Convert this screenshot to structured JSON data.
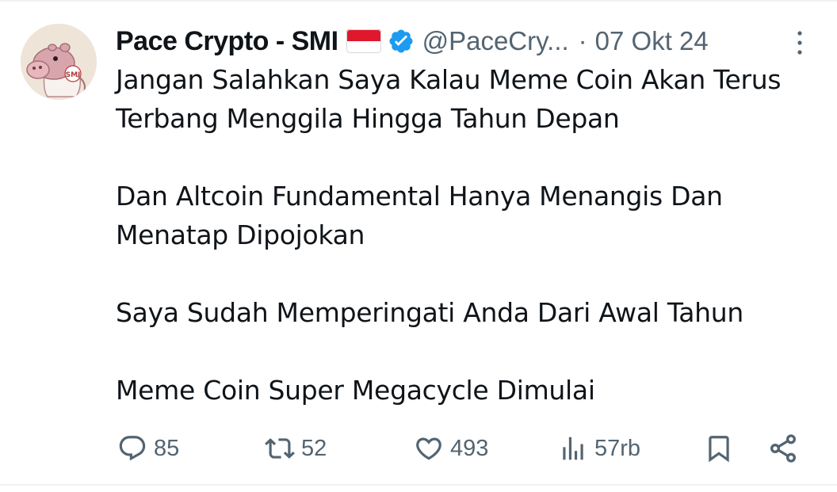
{
  "tweet": {
    "author_name": "Pace Crypto - SMI",
    "handle": "@PaceCry...",
    "separator": "·",
    "date": "07 Okt 24",
    "avatar_badge": "SMI",
    "paragraphs": [
      {
        "line1": "Jangan Salahkan Saya Kalau Meme Coin Akan Terus",
        "line2": "Terbang Menggila Hingga Tahun Depan"
      },
      {
        "line1": "Dan Altcoin Fundamental Hanya Menangis Dan",
        "line2": "Menatap Dipojokan"
      },
      {
        "line1": "Saya Sudah Memperingati Anda Dari Awal Tahun",
        "line2": ""
      },
      {
        "line1": "Meme Coin Super Megacycle Dimulai",
        "line2": ""
      }
    ],
    "actions": {
      "replies": "85",
      "reposts": "52",
      "likes": "493",
      "views": "57rb"
    },
    "icons": {
      "flag": "indonesia-flag-icon",
      "verified": "verified-badge-icon",
      "more": "more-dots-icon",
      "reply": "reply-bubble-icon",
      "repost": "repost-arrows-icon",
      "like": "heart-icon",
      "views": "views-bars-icon",
      "bookmark": "bookmark-icon",
      "share": "share-icon"
    },
    "colors": {
      "text": "#0f1419",
      "secondary": "#536471",
      "verified": "#1d9bf0",
      "flag_red": "#e0182d",
      "divider": "#eff3f4"
    }
  }
}
